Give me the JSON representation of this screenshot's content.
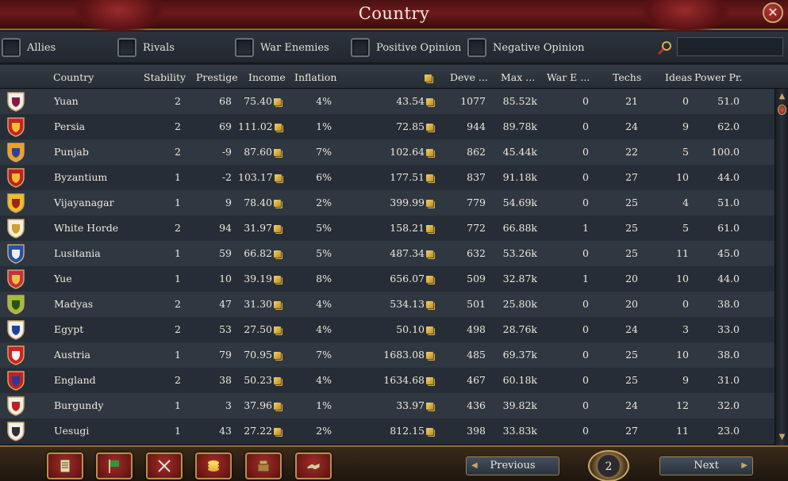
{
  "window": {
    "title": "Country",
    "close_icon": "close-icon"
  },
  "filters": [
    {
      "label": "Allies"
    },
    {
      "label": "Rivals"
    },
    {
      "label": "War Enemies"
    },
    {
      "label": "Positive Opinion"
    },
    {
      "label": "Negative Opinion"
    }
  ],
  "search": {
    "placeholder": ""
  },
  "columns": {
    "country": "Country",
    "stability": "Stability",
    "prestige": "Prestige",
    "income": "Income",
    "inflation": "Inflation",
    "treasury": "",
    "development": "Deve ...",
    "max_manpower": "Max  ...",
    "war_exhaustion": "War E ...",
    "techs": "Techs",
    "ideas": "Ideas",
    "power_projection": "Power Pr."
  },
  "rows": [
    {
      "country": "Yuan",
      "stability": "2",
      "prestige": "68",
      "income": "75.40",
      "inflation": "4%",
      "treasury": "43.54",
      "development": "1077",
      "max_manpower": "85.52k",
      "war_exhaustion": "0",
      "techs": "21",
      "ideas": "0",
      "power_projection": "51.0",
      "flag_colors": [
        "#f2eef0",
        "#8a1a3a"
      ]
    },
    {
      "country": "Persia",
      "stability": "2",
      "prestige": "69",
      "income": "111.02",
      "inflation": "1%",
      "treasury": "72.85",
      "development": "944",
      "max_manpower": "89.78k",
      "war_exhaustion": "0",
      "techs": "24",
      "ideas": "9",
      "power_projection": "62.0",
      "flag_colors": [
        "#c8202a",
        "#f0c030"
      ]
    },
    {
      "country": "Punjab",
      "stability": "2",
      "prestige": "-9",
      "income": "87.60",
      "inflation": "7%",
      "treasury": "102.64",
      "development": "862",
      "max_manpower": "45.44k",
      "war_exhaustion": "0",
      "techs": "22",
      "ideas": "5",
      "power_projection": "100.0",
      "flag_colors": [
        "#f0a020",
        "#2a40a0"
      ]
    },
    {
      "country": "Byzantium",
      "stability": "1",
      "prestige": "-2",
      "income": "103.17",
      "inflation": "6%",
      "treasury": "177.51",
      "development": "837",
      "max_manpower": "91.18k",
      "war_exhaustion": "0",
      "techs": "27",
      "ideas": "10",
      "power_projection": "44.0",
      "flag_colors": [
        "#c02020",
        "#f0c030"
      ]
    },
    {
      "country": "Vijayanagar",
      "stability": "1",
      "prestige": "9",
      "income": "78.40",
      "inflation": "2%",
      "treasury": "399.99",
      "development": "779",
      "max_manpower": "54.69k",
      "war_exhaustion": "0",
      "techs": "25",
      "ideas": "4",
      "power_projection": "51.0",
      "flag_colors": [
        "#f0c020",
        "#a02020"
      ]
    },
    {
      "country": "White Horde",
      "stability": "2",
      "prestige": "94",
      "income": "31.97",
      "inflation": "5%",
      "treasury": "158.21",
      "development": "772",
      "max_manpower": "66.88k",
      "war_exhaustion": "1",
      "techs": "25",
      "ideas": "5",
      "power_projection": "61.0",
      "flag_colors": [
        "#f4f0e0",
        "#d0a030"
      ]
    },
    {
      "country": "Lusitania",
      "stability": "1",
      "prestige": "59",
      "income": "66.82",
      "inflation": "5%",
      "treasury": "487.34",
      "development": "632",
      "max_manpower": "53.26k",
      "war_exhaustion": "0",
      "techs": "25",
      "ideas": "11",
      "power_projection": "45.0",
      "flag_colors": [
        "#2050b0",
        "#f0f0f0"
      ]
    },
    {
      "country": "Yue",
      "stability": "1",
      "prestige": "10",
      "income": "39.19",
      "inflation": "8%",
      "treasury": "656.07",
      "development": "509",
      "max_manpower": "32.87k",
      "war_exhaustion": "1",
      "techs": "20",
      "ideas": "10",
      "power_projection": "44.0",
      "flag_colors": [
        "#c83040",
        "#f0c040"
      ]
    },
    {
      "country": "Madyas",
      "stability": "2",
      "prestige": "47",
      "income": "31.30",
      "inflation": "4%",
      "treasury": "534.13",
      "development": "501",
      "max_manpower": "25.80k",
      "war_exhaustion": "0",
      "techs": "20",
      "ideas": "0",
      "power_projection": "38.0",
      "flag_colors": [
        "#a0c030",
        "#2a5020"
      ]
    },
    {
      "country": "Egypt",
      "stability": "2",
      "prestige": "53",
      "income": "27.50",
      "inflation": "4%",
      "treasury": "50.10",
      "development": "498",
      "max_manpower": "28.76k",
      "war_exhaustion": "0",
      "techs": "24",
      "ideas": "3",
      "power_projection": "33.0",
      "flag_colors": [
        "#f0f0f0",
        "#2040a0"
      ]
    },
    {
      "country": "Austria",
      "stability": "1",
      "prestige": "79",
      "income": "70.95",
      "inflation": "7%",
      "treasury": "1683.08",
      "development": "485",
      "max_manpower": "69.37k",
      "war_exhaustion": "0",
      "techs": "25",
      "ideas": "10",
      "power_projection": "38.0",
      "flag_colors": [
        "#d02020",
        "#f4f4f4"
      ]
    },
    {
      "country": "England",
      "stability": "2",
      "prestige": "38",
      "income": "50.23",
      "inflation": "4%",
      "treasury": "1634.68",
      "development": "467",
      "max_manpower": "60.18k",
      "war_exhaustion": "0",
      "techs": "25",
      "ideas": "9",
      "power_projection": "31.0",
      "flag_colors": [
        "#c02020",
        "#2a3a9a"
      ]
    },
    {
      "country": "Burgundy",
      "stability": "1",
      "prestige": "3",
      "income": "37.96",
      "inflation": "1%",
      "treasury": "33.97",
      "development": "436",
      "max_manpower": "39.82k",
      "war_exhaustion": "0",
      "techs": "24",
      "ideas": "12",
      "power_projection": "32.0",
      "flag_colors": [
        "#f4f0e8",
        "#c02020"
      ]
    },
    {
      "country": "Uesugi",
      "stability": "1",
      "prestige": "43",
      "income": "27.22",
      "inflation": "2%",
      "treasury": "812.15",
      "development": "398",
      "max_manpower": "33.83k",
      "war_exhaustion": "0",
      "techs": "27",
      "ideas": "11",
      "power_projection": "23.0",
      "flag_colors": [
        "#f0f0f0",
        "#303030"
      ]
    }
  ],
  "toolbar": {
    "buttons": [
      {
        "icon": "scroll-icon"
      },
      {
        "icon": "flag-icon"
      },
      {
        "icon": "crossed-swords-icon"
      },
      {
        "icon": "coins-icon"
      },
      {
        "icon": "trade-goods-icon"
      },
      {
        "icon": "handshake-icon"
      }
    ]
  },
  "pagination": {
    "previous_label": "Previous",
    "next_label": "Next",
    "page": "2"
  },
  "colors": {
    "accent_red": "#6e1a1c",
    "gold_trim": "#c9a86a",
    "row_even": "#2f3741",
    "row_odd": "#262d36"
  }
}
